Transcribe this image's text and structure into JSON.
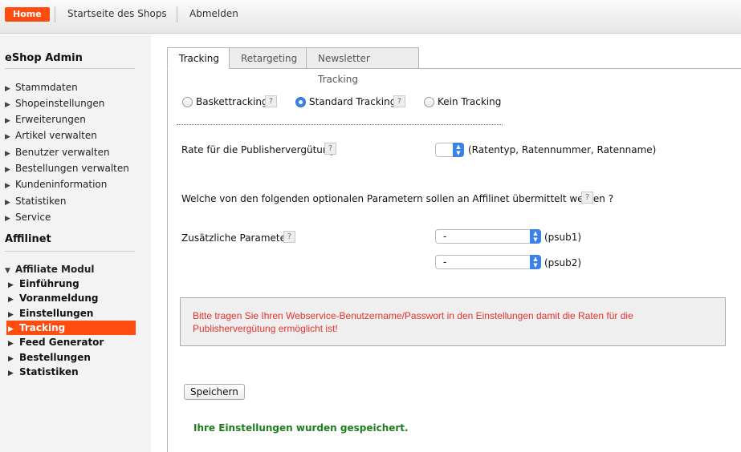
{
  "topbar": {
    "home": "Home",
    "shop_link": "Startseite des Shops",
    "logout": "Abmelden"
  },
  "sidebar": {
    "title_admin": "eShop Admin",
    "admin_items": [
      "Stammdaten",
      "Shopeinstellungen",
      "Erweiterungen",
      "Artikel verwalten",
      "Benutzer verwalten",
      "Bestellungen verwalten",
      "Kundeninformation",
      "Statistiken",
      "Service"
    ],
    "title_affilinet": "Affilinet",
    "module": "Affiliate Modul",
    "module_items": [
      "Einführung",
      "Voranmeldung",
      "Einstellungen",
      "Tracking",
      "Feed Generator",
      "Bestellungen",
      "Statistiken"
    ],
    "active_item": "Tracking"
  },
  "tabs": [
    "Tracking",
    "Retargeting",
    "Newsletter Tracking"
  ],
  "tracking": {
    "options": [
      "Baskettracking",
      "Standard Tracking",
      "Kein Tracking"
    ],
    "selected": "Standard Tracking",
    "help_glyph": "?",
    "rate_label": "Rate für die Publishervergütung",
    "rate_hint": "(Ratentyp, Ratennummer, Ratenname)",
    "rate_value": "",
    "params_question": "Welche von den folgenden optionalen Parametern sollen an Affilinet übermittelt werden ?",
    "extra_label": "Zusätzliche Parameter",
    "psub1_value": "-",
    "psub1_label": "(psub1)",
    "psub2_value": "-",
    "psub2_label": "(psub2)",
    "error_message": "Bitte tragen Sie Ihren Webservice-Benutzername/Passwort in den Einstellungen damit die Raten für die Publishervergütung ermöglicht ist!",
    "save_button": "Speichern",
    "success_message": "Ihre Einstellungen wurden gespeichert."
  },
  "colors": {
    "accent": "#ff4d12",
    "select_blue": "#3b82e8",
    "error_red": "#e8332c",
    "success_green": "#1e7e1e"
  }
}
